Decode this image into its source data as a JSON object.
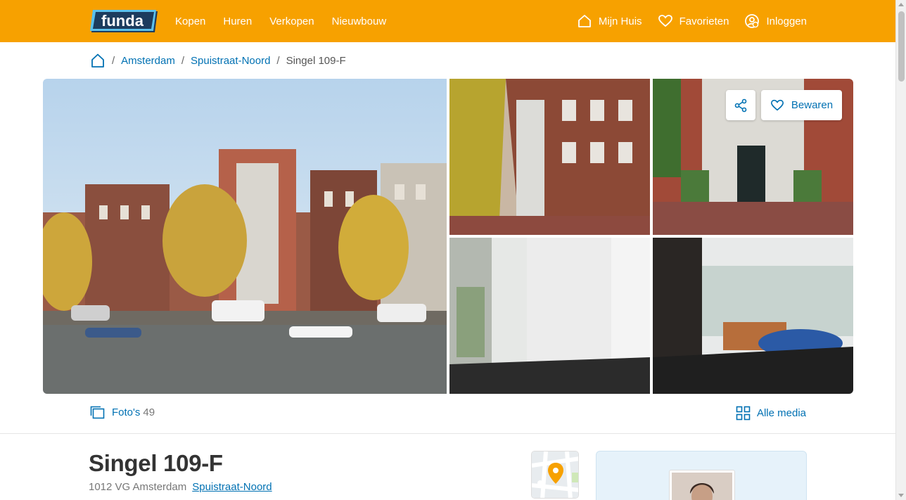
{
  "header": {
    "logo_text": "funda",
    "nav": [
      "Kopen",
      "Huren",
      "Verkopen",
      "Nieuwbouw"
    ],
    "mijn_huis": "Mijn Huis",
    "favorieten": "Favorieten",
    "inloggen": "Inloggen",
    "brand_color": "#f7a100"
  },
  "breadcrumb": {
    "city": "Amsterdam",
    "neighbourhood": "Spuistraat-Noord",
    "current": "Singel 109-F"
  },
  "gallery": {
    "save_label": "Bewaren",
    "photos_label": "Foto's",
    "photos_count": "49",
    "all_media_label": "Alle media"
  },
  "listing": {
    "title": "Singel 109-F",
    "postal": "1012 VG Amsterdam",
    "neighbourhood": "Spuistraat-Noord"
  },
  "colors": {
    "link": "#0071b3",
    "header": "#f7a100"
  }
}
